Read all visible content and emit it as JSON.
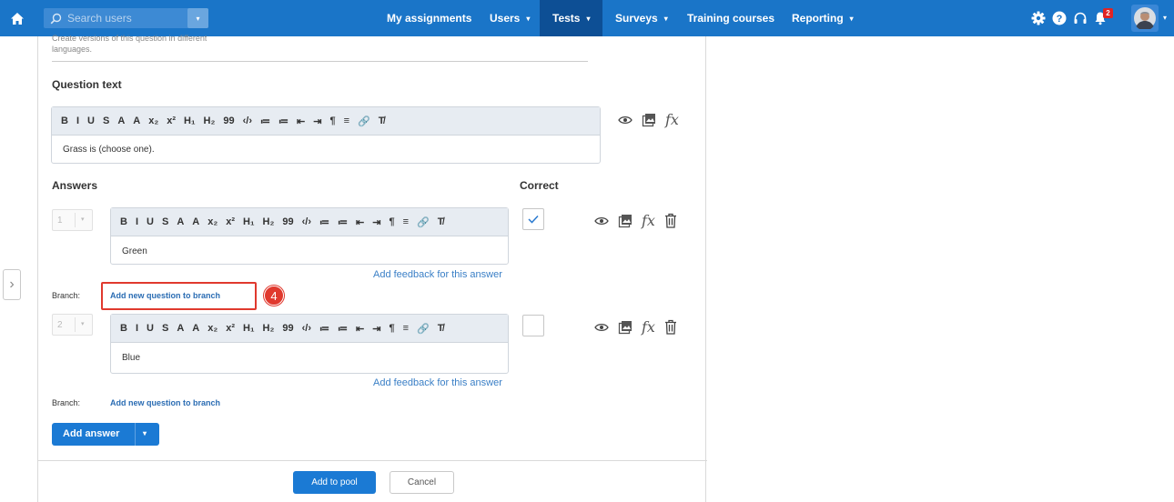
{
  "topbar": {
    "search_placeholder": "Search users",
    "nav": [
      {
        "label": "My assignments",
        "has_caret": false
      },
      {
        "label": "Users",
        "has_caret": true
      },
      {
        "label": "Tests",
        "has_caret": true,
        "active": true
      },
      {
        "label": "Surveys",
        "has_caret": true
      },
      {
        "label": "Training courses",
        "has_caret": false
      },
      {
        "label": "Reporting",
        "has_caret": true
      }
    ],
    "caret": "▾",
    "notification_count": "2",
    "icons": [
      "home-icon",
      "search-icon",
      "gear-icon",
      "help-icon",
      "headset-icon",
      "bell-icon",
      "avatar"
    ]
  },
  "colors": {
    "nav_bg": "#1a75c8",
    "nav_active": "#0d4f95",
    "primary_button": "#1b7ad4",
    "highlight": "#e0392e"
  },
  "question": {
    "translation_hint_line1": "Create versions of this question in different",
    "translation_hint_line2": "languages.",
    "text_label": "Question text",
    "text_value": "Grass is (choose one)."
  },
  "editor_toolbar": [
    "B",
    "I",
    "U",
    "S",
    "A",
    "A",
    "x₂",
    "x²",
    "H₁",
    "H₂",
    "99",
    "‹/›",
    "≔",
    "≔",
    "⇤",
    "⇥",
    "¶",
    "≡",
    "🔗",
    "T̸"
  ],
  "answers": {
    "label": "Answers",
    "correct_label": "Correct",
    "feedback_link": "Add feedback for this answer",
    "branch_label": "Branch:",
    "branch_link": "Add new question to branch",
    "items": [
      {
        "number": "1",
        "text": "Green",
        "correct": true
      },
      {
        "number": "2",
        "text": "Blue",
        "correct": false
      }
    ]
  },
  "annotation_step": "4",
  "add_answer_label": "Add answer",
  "footer": {
    "add_to_pool": "Add to pool",
    "cancel": "Cancel"
  }
}
